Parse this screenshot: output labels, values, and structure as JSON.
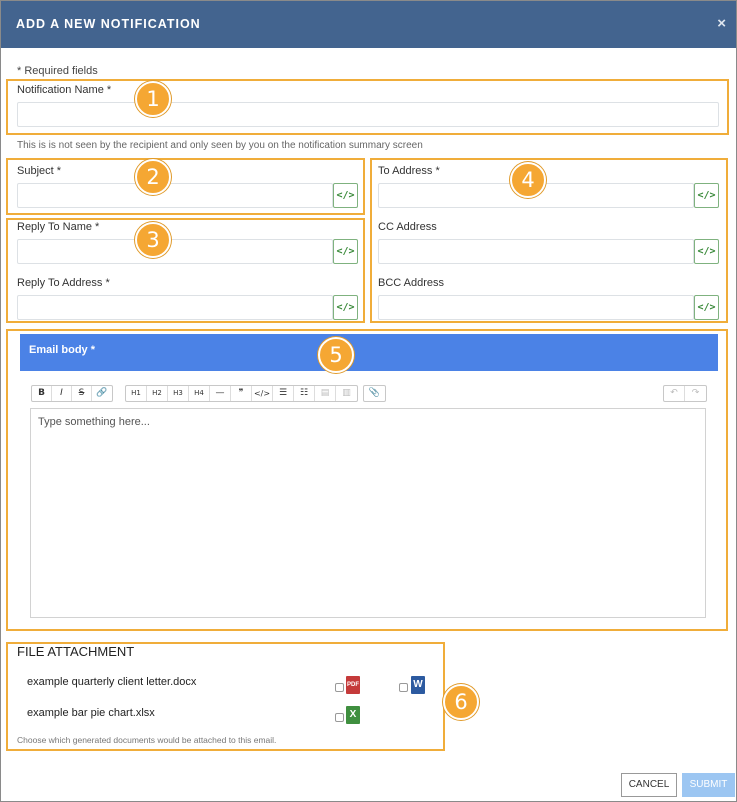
{
  "modal": {
    "title": "ADD A NEW NOTIFICATION",
    "close": "×"
  },
  "required_note": "* Required fields",
  "badges": [
    "1",
    "2",
    "3",
    "4",
    "5",
    "6"
  ],
  "notification_name": {
    "label": "Notification Name *",
    "value": "",
    "help": "This is is not seen by the recipient and only seen by you on the notification summary screen"
  },
  "subject": {
    "label": "Subject *",
    "value": ""
  },
  "reply_to_name": {
    "label": "Reply To Name *",
    "value": ""
  },
  "reply_to_address": {
    "label": "Reply To Address *",
    "value": ""
  },
  "to_address": {
    "label": "To Address *",
    "value": ""
  },
  "cc_address": {
    "label": "CC Address",
    "value": ""
  },
  "bcc_address": {
    "label": "BCC Address",
    "value": ""
  },
  "code_button": "</>",
  "email_body": {
    "label": "Email body *",
    "placeholder": "Type something here...",
    "toolbar": {
      "bold": "B",
      "italic": "I",
      "strike": "S",
      "link": "🔗",
      "h1": "H1",
      "h2": "H2",
      "h3": "H3",
      "h4": "H4",
      "hr": "—",
      "quote": "❞",
      "code": "</>",
      "ul": "☰",
      "ol": "☷",
      "indent": "▤",
      "outdent": "▥",
      "attach": "📎",
      "undo": "↶",
      "redo": "↷"
    }
  },
  "file_attachment": {
    "title": "FILE ATTACHMENT",
    "files": [
      {
        "name": "example quarterly client letter.docx",
        "types": [
          "PDF",
          "W"
        ]
      },
      {
        "name": "example bar pie chart.xlsx",
        "types": [
          "X"
        ]
      }
    ],
    "help": "Choose which generated documents would be attached to this email."
  },
  "buttons": {
    "cancel": "CANCEL",
    "submit": "SUBMIT"
  },
  "colors": {
    "header": "#43648f",
    "highlight": "#f0ad3a",
    "email_header": "#4b82e6",
    "submit": "#9cc6f2"
  }
}
